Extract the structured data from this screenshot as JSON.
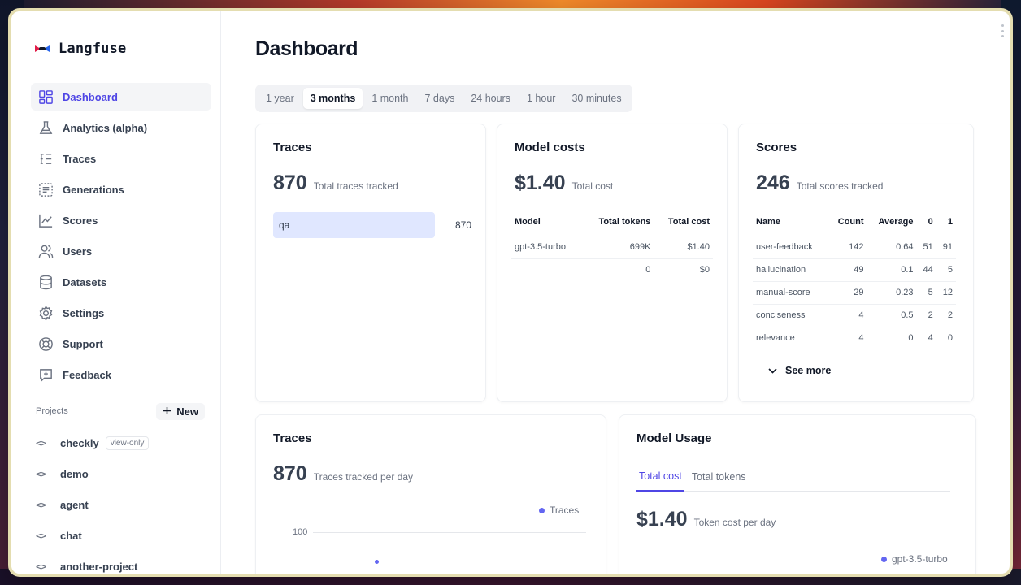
{
  "app": {
    "name": "Langfuse"
  },
  "sidebar": {
    "items": [
      {
        "label": "Dashboard",
        "icon": "dashboard-icon",
        "active": true
      },
      {
        "label": "Analytics (alpha)",
        "icon": "flask-icon"
      },
      {
        "label": "Traces",
        "icon": "traces-list-icon"
      },
      {
        "label": "Generations",
        "icon": "generations-icon"
      },
      {
        "label": "Scores",
        "icon": "line-chart-icon"
      },
      {
        "label": "Users",
        "icon": "users-icon"
      },
      {
        "label": "Datasets",
        "icon": "database-icon"
      },
      {
        "label": "Settings",
        "icon": "gear-icon"
      },
      {
        "label": "Support",
        "icon": "lifebuoy-icon"
      },
      {
        "label": "Feedback",
        "icon": "feedback-icon"
      }
    ],
    "projects_label": "Projects",
    "new_label": "New",
    "projects": [
      {
        "name": "checkly",
        "badge": "view-only"
      },
      {
        "name": "demo"
      },
      {
        "name": "agent"
      },
      {
        "name": "chat"
      },
      {
        "name": "another-project"
      }
    ]
  },
  "page": {
    "title": "Dashboard",
    "time_ranges": [
      "1 year",
      "3 months",
      "1 month",
      "7 days",
      "24 hours",
      "1 hour",
      "30 minutes"
    ],
    "active_range": "3 months"
  },
  "traces_card": {
    "title": "Traces",
    "value": "870",
    "caption": "Total traces tracked",
    "bar": {
      "label": "qa",
      "count": "870",
      "fraction": 1.0
    }
  },
  "costs_card": {
    "title": "Model costs",
    "value": "$1.40",
    "caption": "Total cost",
    "headers": [
      "Model",
      "Total tokens",
      "Total cost"
    ],
    "rows": [
      [
        "gpt-3.5-turbo",
        "699K",
        "$1.40"
      ],
      [
        "",
        "0",
        "$0"
      ]
    ]
  },
  "scores_card": {
    "title": "Scores",
    "value": "246",
    "caption": "Total scores tracked",
    "headers": [
      "Name",
      "Count",
      "Average",
      "0",
      "1"
    ],
    "rows": [
      [
        "user-feedback",
        "142",
        "0.64",
        "51",
        "91"
      ],
      [
        "hallucination",
        "49",
        "0.1",
        "44",
        "5"
      ],
      [
        "manual-score",
        "29",
        "0.23",
        "5",
        "12"
      ],
      [
        "conciseness",
        "4",
        "0.5",
        "2",
        "2"
      ],
      [
        "relevance",
        "4",
        "0",
        "4",
        "0"
      ]
    ],
    "see_more": "See more"
  },
  "traces_chart_card": {
    "title": "Traces",
    "value": "870",
    "caption": "Traces tracked per day",
    "legend": "Traces",
    "y_tick": "100"
  },
  "usage_card": {
    "title": "Model Usage",
    "tabs": [
      "Total cost",
      "Total tokens"
    ],
    "active_tab": "Total cost",
    "value": "$1.40",
    "caption": "Token cost per day",
    "legend": "gpt-3.5-turbo"
  },
  "colors": {
    "accent": "#4f46e5",
    "bar": "#e0e7ff",
    "series": "#6366f1"
  }
}
